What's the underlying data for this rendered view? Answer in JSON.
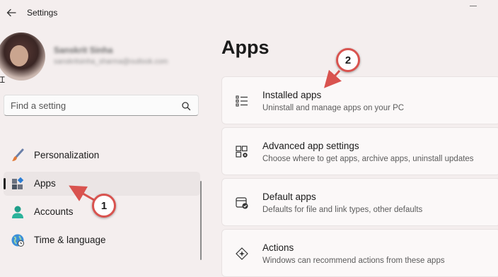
{
  "window": {
    "title": "Settings"
  },
  "user": {
    "name": "Sanskrit Sinha",
    "email": "sanskritsinha_sharma@outlook.com"
  },
  "search": {
    "placeholder": "Find a setting"
  },
  "nav": {
    "items": [
      {
        "label": "Personalization",
        "icon": "brush-icon"
      },
      {
        "label": "Apps",
        "icon": "apps-icon",
        "selected": true
      },
      {
        "label": "Accounts",
        "icon": "person-icon"
      },
      {
        "label": "Time & language",
        "icon": "globe-icon"
      }
    ]
  },
  "main": {
    "title": "Apps",
    "cards": [
      {
        "title": "Installed apps",
        "desc": "Uninstall and manage apps on your PC",
        "icon": "list-icon"
      },
      {
        "title": "Advanced app settings",
        "desc": "Choose where to get apps, archive apps, uninstall updates",
        "icon": "app-settings-icon"
      },
      {
        "title": "Default apps",
        "desc": "Defaults for file and link types, other defaults",
        "icon": "default-apps-icon"
      },
      {
        "title": "Actions",
        "desc": "Windows can recommend actions from these apps",
        "icon": "actions-icon"
      }
    ]
  },
  "annotations": {
    "step1": "1",
    "step2": "2"
  },
  "colors": {
    "accent": "#0067c0",
    "callout": "#d9534f",
    "background": "#f4eeee"
  }
}
